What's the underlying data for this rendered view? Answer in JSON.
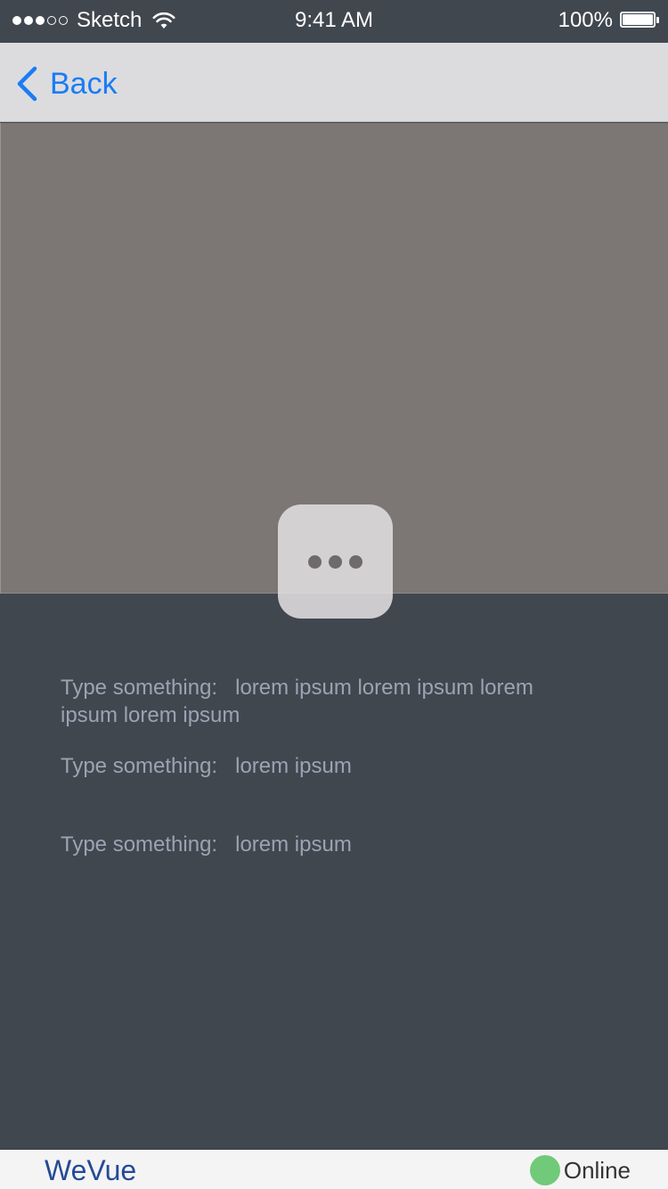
{
  "status_bar": {
    "signal_bars_filled": 3,
    "signal_bars_total": 5,
    "carrier": "Sketch",
    "time": "9:41 AM",
    "battery_percent": "100%",
    "icons": [
      "signal-dots-icon",
      "wifi-icon",
      "battery-icon"
    ]
  },
  "nav": {
    "back_label": "Back",
    "accent_color": "#1a7cf5"
  },
  "more_button": {
    "icon": "more-dots-icon"
  },
  "details": [
    {
      "label": "Type something:",
      "value": "lorem ipsum lorem ipsum lorem ipsum lorem ipsum"
    },
    {
      "label": "Type something:",
      "value": "lorem ipsum"
    },
    {
      "label": "Type something:",
      "value": "lorem ipsum"
    }
  ],
  "footer": {
    "brand": "WeVue",
    "status": "Online",
    "status_color": "#71c97a",
    "brand_color": "#244a96"
  }
}
